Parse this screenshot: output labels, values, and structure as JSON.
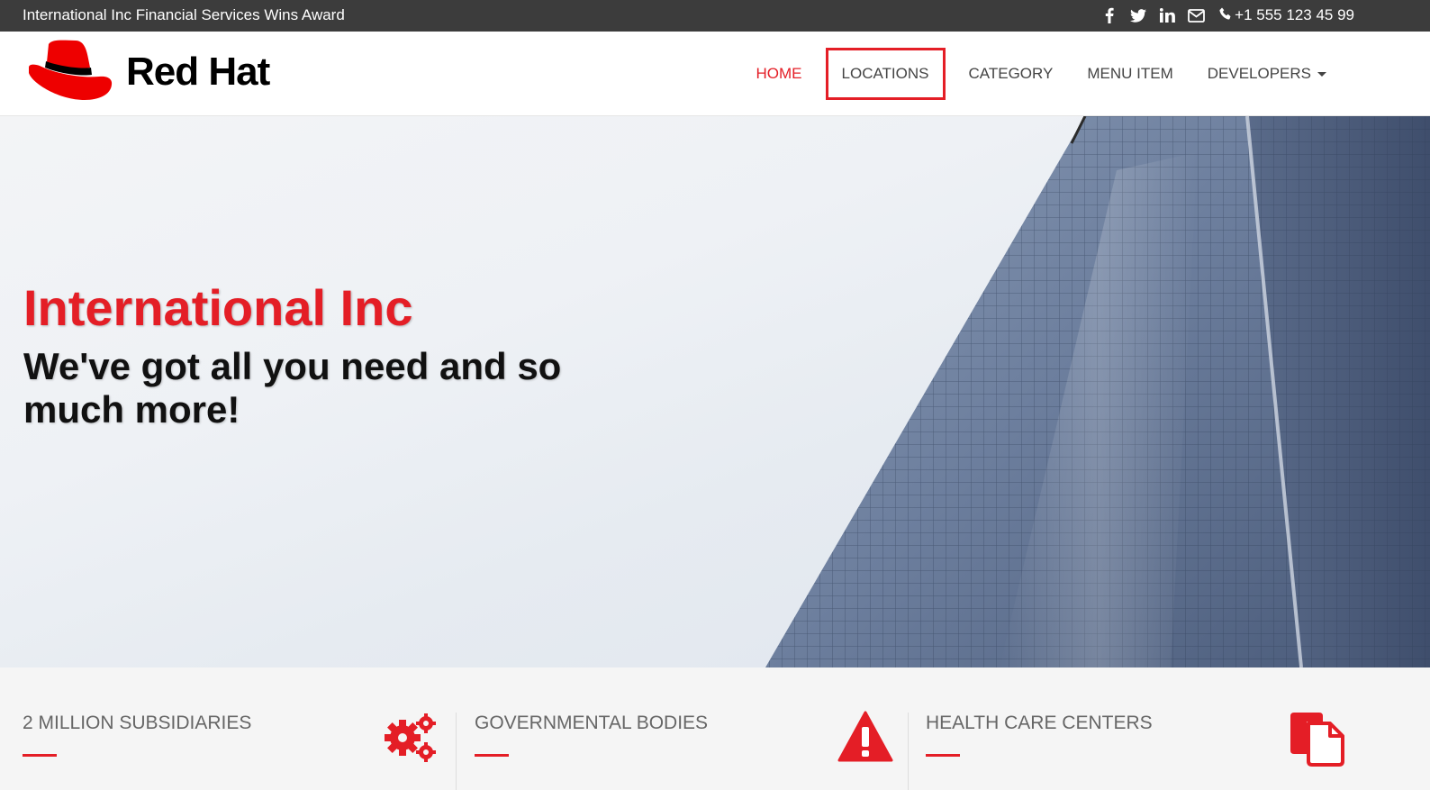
{
  "topbar": {
    "announcement": "International Inc Financial Services Wins Award",
    "social": [
      {
        "icon": "facebook-icon"
      },
      {
        "icon": "twitter-icon"
      },
      {
        "icon": "linkedin-icon"
      },
      {
        "icon": "envelope-icon"
      }
    ],
    "phone_icon": "phone-icon",
    "phone": "+1 555 123 45 99"
  },
  "header": {
    "logo_text": "Red Hat",
    "nav": [
      {
        "label": "HOME",
        "state": "active"
      },
      {
        "label": "LOCATIONS",
        "state": "highlighted"
      },
      {
        "label": "CATEGORY"
      },
      {
        "label": "MENU ITEM"
      },
      {
        "label": "DEVELOPERS",
        "dropdown": true
      }
    ]
  },
  "hero": {
    "title": "International Inc",
    "subtitle": "We've got all you need and so much more!"
  },
  "features": [
    {
      "title": "2 MILLION SUBSIDIARIES",
      "icon": "cogs-icon"
    },
    {
      "title": "GOVERNMENTAL BODIES",
      "icon": "warning-icon"
    },
    {
      "title": "HEALTH CARE CENTERS",
      "icon": "copy-files-icon"
    }
  ],
  "colors": {
    "accent": "#e41e26",
    "topbar_bg": "#3c3c3c",
    "features_bg": "#f5f5f5"
  }
}
